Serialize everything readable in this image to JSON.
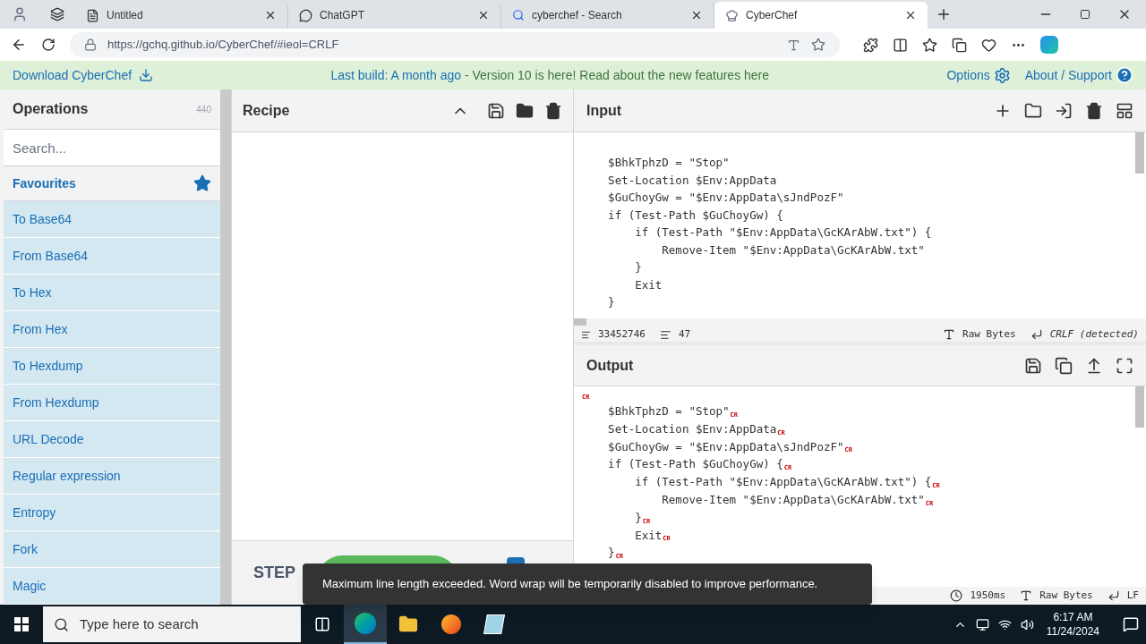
{
  "browser": {
    "tabs": [
      {
        "title": "Untitled",
        "kind": "page",
        "selected": false
      },
      {
        "title": "ChatGPT",
        "kind": "chat",
        "selected": false
      },
      {
        "title": "cyberchef - Search",
        "kind": "search",
        "selected": false
      },
      {
        "title": "CyberChef",
        "kind": "chef",
        "selected": true
      }
    ],
    "url": "https://gchq.github.io/CyberChef/#ieol=CRLF"
  },
  "banner": {
    "download": "Download CyberChef",
    "build": "Last build: A month ago",
    "notice": " - Version 10 is here! Read about the new features here",
    "options": "Options",
    "about": "About / Support"
  },
  "operations": {
    "title": "Operations",
    "count": "440",
    "search_placeholder": "Search...",
    "favourites": "Favourites",
    "items": [
      "To Base64",
      "From Base64",
      "To Hex",
      "From Hex",
      "To Hexdump",
      "From Hexdump",
      "URL Decode",
      "Regular expression",
      "Entropy",
      "Fork",
      "Magic"
    ]
  },
  "recipe": {
    "title": "Recipe",
    "step": "STEP",
    "auto_bake": true
  },
  "input": {
    "title": "Input",
    "lines": [
      "    $BhkTphzD = \"Stop\"",
      "    Set-Location $Env:AppData",
      "    $GuChoyGw = \"$Env:AppData\\sJndPozF\"",
      "    if (Test-Path $GuChoyGw) {",
      "        if (Test-Path \"$Env:AppData\\GcKArAbW.txt\") {",
      "            Remove-Item \"$Env:AppData\\GcKArAbW.txt\"",
      "        }",
      "        Exit",
      "    }"
    ],
    "length": "33452746",
    "line_count": "47",
    "encoding": "Raw Bytes",
    "eol": "CRLF (detected)"
  },
  "output": {
    "title": "Output",
    "lines": [
      {
        "mark": "CR"
      },
      {
        "text": "    $BhkTphzD = \"Stop\"",
        "mark": "CR"
      },
      {
        "text": "    Set-Location $Env:AppData",
        "mark": "CR"
      },
      {
        "text": "    $GuChoyGw = \"$Env:AppData\\sJndPozF\"",
        "mark": "CR"
      },
      {
        "text": "    if (Test-Path $GuChoyGw) {",
        "mark": "CR"
      },
      {
        "text": "        if (Test-Path \"$Env:AppData\\GcKArAbW.txt\") {",
        "mark": "CR"
      },
      {
        "text": "            Remove-Item \"$Env:AppData\\GcKArAbW.txt\"",
        "mark": "CR"
      },
      {
        "text": "        }",
        "mark": "CR"
      },
      {
        "text": "        Exit",
        "mark": "CR"
      },
      {
        "text": "    }",
        "mark": "CR"
      }
    ],
    "time": "1950ms",
    "encoding": "Raw Bytes",
    "eol": "LF"
  },
  "toast": "Maximum line length exceeded. Word wrap will be temporarily disabled to improve performance.",
  "taskbar": {
    "search_placeholder": "Type here to search",
    "time": "6:17 AM",
    "date": "11/24/2024"
  }
}
